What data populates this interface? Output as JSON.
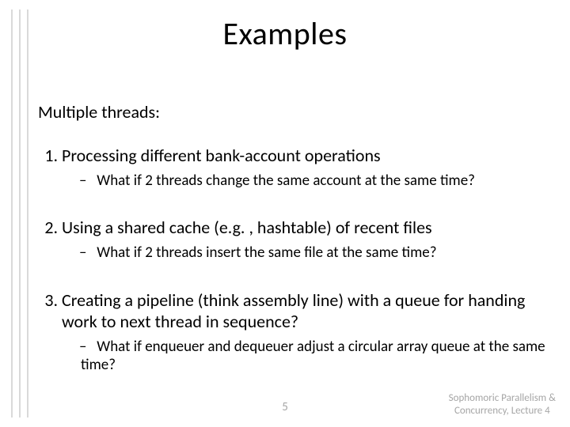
{
  "title": "Examples",
  "intro": "Multiple threads:",
  "items": [
    {
      "main": "Processing different bank-account operations",
      "sub": "What if 2 threads change the same account at the same time?"
    },
    {
      "main": "Using a shared cache (e.g. , hashtable) of recent files",
      "sub": "What if 2 threads insert the same file at the same time?"
    },
    {
      "main": "Creating a pipeline (think assembly line) with a queue for handing work to next thread in sequence?",
      "sub": "What if enqueuer and dequeuer adjust a circular array queue at the same time?"
    }
  ],
  "pageNumber": "5",
  "footer": {
    "line1": "Sophomoric Parallelism &",
    "line2": "Concurrency, Lecture 4"
  }
}
